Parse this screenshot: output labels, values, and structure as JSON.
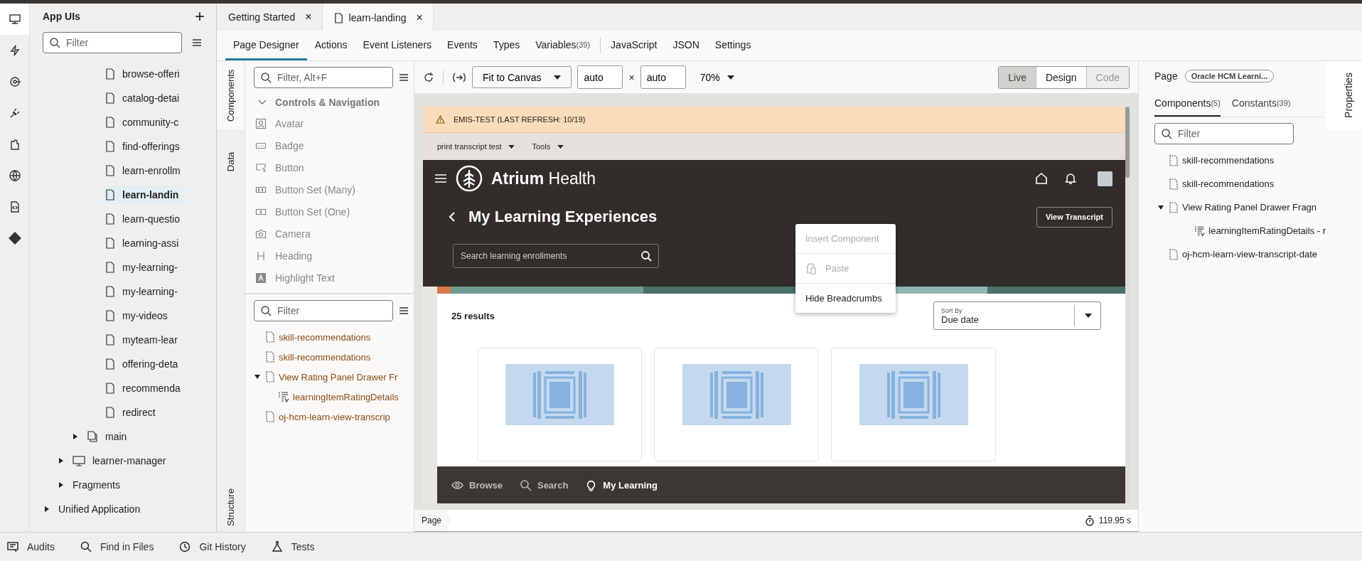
{
  "activity_bar": [
    {
      "kind": "monitor",
      "selected": true
    },
    {
      "kind": "bolt",
      "selected": false
    },
    {
      "kind": "target",
      "selected": false
    },
    {
      "kind": "plug",
      "selected": false
    },
    {
      "kind": "puzzle",
      "selected": false
    },
    {
      "kind": "globe",
      "selected": false
    },
    {
      "kind": "code",
      "selected": false
    },
    {
      "kind": "git",
      "selected": false
    }
  ],
  "navigator": {
    "title": "App UIs",
    "add": "+",
    "filter": {
      "placeholder": "Filter"
    },
    "items": [
      {
        "label": "browse-offeri",
        "kind": "page",
        "selected": false
      },
      {
        "label": "catalog-detai",
        "kind": "page",
        "selected": false
      },
      {
        "label": "community-c",
        "kind": "page",
        "selected": false
      },
      {
        "label": "find-offerings",
        "kind": "page",
        "selected": false
      },
      {
        "label": "learn-enrollm",
        "kind": "page",
        "selected": false
      },
      {
        "label": "learn-landin",
        "kind": "page",
        "selected": true
      },
      {
        "label": "learn-questio",
        "kind": "page",
        "selected": false
      },
      {
        "label": "learning-assi",
        "kind": "page",
        "selected": false
      },
      {
        "label": "my-learning-",
        "kind": "page",
        "selected": false
      },
      {
        "label": "my-learning-",
        "kind": "page",
        "selected": false
      },
      {
        "label": "my-videos",
        "kind": "page",
        "selected": false
      },
      {
        "label": "myteam-lear",
        "kind": "page",
        "selected": false
      },
      {
        "label": "offering-deta",
        "kind": "page",
        "selected": false
      },
      {
        "label": "recommenda",
        "kind": "page",
        "selected": false
      },
      {
        "label": "redirect",
        "kind": "page",
        "selected": false
      },
      {
        "label": "main",
        "kind": "flow",
        "selected": false
      },
      {
        "label": "learner-manager",
        "kind": "app",
        "selected": false
      },
      {
        "label": "Fragments",
        "kind": "folder",
        "selected": false
      },
      {
        "label": "Unified Application",
        "kind": "root",
        "selected": false
      }
    ]
  },
  "editor_tabs": [
    {
      "label": "Getting Started",
      "close": "×",
      "selected": false,
      "kind": "plain"
    },
    {
      "label": "learn-landing",
      "close": "×",
      "selected": true,
      "kind": "page"
    }
  ],
  "sub_tab_groups": [
    [
      {
        "label": "Page Designer",
        "selected": true
      },
      {
        "label": "Actions",
        "selected": false
      },
      {
        "label": "Event Listeners",
        "selected": false
      },
      {
        "label": "Events",
        "selected": false
      },
      {
        "label": "Types",
        "selected": false
      },
      {
        "label": "Variables",
        "count": "(39)",
        "selected": false
      }
    ],
    [
      {
        "label": "JavaScript",
        "selected": false
      },
      {
        "label": "JSON",
        "selected": false
      },
      {
        "label": "Settings",
        "selected": false
      }
    ]
  ],
  "side_tabs": [
    {
      "label": "Components",
      "selected": true
    },
    {
      "label": "Data",
      "selected": false
    }
  ],
  "structure_tab": {
    "label": "Structure",
    "selected": false
  },
  "palette": {
    "filter": {
      "placeholder": "Filter, Alt+F"
    },
    "section": {
      "label": "Controls & Navigation",
      "expanded": true
    },
    "items": [
      {
        "label": "Avatar",
        "kind": "avatar"
      },
      {
        "label": "Badge",
        "kind": "badge"
      },
      {
        "label": "Button",
        "kind": "button"
      },
      {
        "label": "Button Set (Many)",
        "kind": "many"
      },
      {
        "label": "Button Set (One)",
        "kind": "one"
      },
      {
        "label": "Camera",
        "kind": "camera"
      },
      {
        "label": "Heading",
        "kind": "heading"
      },
      {
        "label": "Highlight Text",
        "kind": "highlight"
      }
    ]
  },
  "structure": {
    "filter": {
      "placeholder": "Filter"
    },
    "items": [
      {
        "label": "skill-recommendations",
        "kind": "fragment"
      },
      {
        "label": "skill-recommendations",
        "kind": "fragment"
      },
      {
        "label": "View Rating Panel Drawer Fr",
        "kind": "fragment",
        "expanded": true,
        "children": [
          {
            "label": "learningItemRatingDetails",
            "kind": "variable"
          }
        ]
      },
      {
        "label": "oj-hcm-learn-view-transcrip",
        "kind": "fragment"
      }
    ]
  },
  "toolbar": {
    "fit": "Fit to Canvas",
    "width": "auto",
    "times": "×",
    "height": "auto",
    "zoom": "70%",
    "modes": [
      {
        "label": "Live",
        "selected": true,
        "disabled": false
      },
      {
        "label": "Design",
        "selected": false,
        "disabled": false
      },
      {
        "label": "Code",
        "selected": false,
        "disabled": true
      }
    ]
  },
  "preview": {
    "banner": "EMIS-TEST (LAST REFRESH: 10/19)",
    "menus": [
      "print transcript test",
      "Tools"
    ],
    "brand": "**Atrium** Health",
    "title": "My Learning Experiences",
    "transcript_button": "View Transcript",
    "search": {
      "placeholder": "Search learning enrollments"
    },
    "results": "25 results",
    "sort": {
      "label": "Sort By",
      "value": "Due date"
    },
    "cards": [
      {
        "kind": "video"
      },
      {
        "kind": "video"
      },
      {
        "kind": "video"
      }
    ],
    "bottom_nav": [
      {
        "label": "Browse",
        "kind": "eye",
        "selected": false
      },
      {
        "label": "Search",
        "kind": "search",
        "selected": false
      },
      {
        "label": "My Learning",
        "kind": "bulb",
        "selected": true
      }
    ]
  },
  "context_menu": [
    {
      "label": "Insert Component",
      "kind": "plain",
      "disabled": true
    },
    {
      "label": "Paste",
      "kind": "paste",
      "disabled": true
    },
    {
      "label": "Hide Breadcrumbs",
      "kind": "plain",
      "disabled": false
    }
  ],
  "status": {
    "breadcrumb": "Page",
    "timer": "119.95 s"
  },
  "properties": {
    "label": "Page",
    "chip": "Oracle HCM Learni...",
    "tabs": [
      {
        "label": "Components",
        "count": "(5)",
        "selected": true
      },
      {
        "label": "Constants",
        "count": "(39)",
        "selected": false
      }
    ],
    "filter": {
      "placeholder": "Filter"
    },
    "items": [
      {
        "label": "skill-recommendations",
        "kind": "fragment"
      },
      {
        "label": "skill-recommendations",
        "kind": "fragment"
      },
      {
        "label": "View Rating Panel Drawer Fragn",
        "kind": "fragment",
        "expanded": true,
        "children": [
          {
            "label": "learningItemRatingDetails - r",
            "kind": "variable"
          }
        ]
      },
      {
        "label": "oj-hcm-learn-view-transcript-date",
        "kind": "fragment"
      }
    ],
    "tab": "Properties"
  },
  "bottom_tools": [
    {
      "label": "Audits",
      "kind": "audits"
    },
    {
      "label": "Find in Files",
      "kind": "find"
    },
    {
      "label": "Git History",
      "kind": "history"
    },
    {
      "label": "Tests",
      "kind": "tests"
    }
  ]
}
